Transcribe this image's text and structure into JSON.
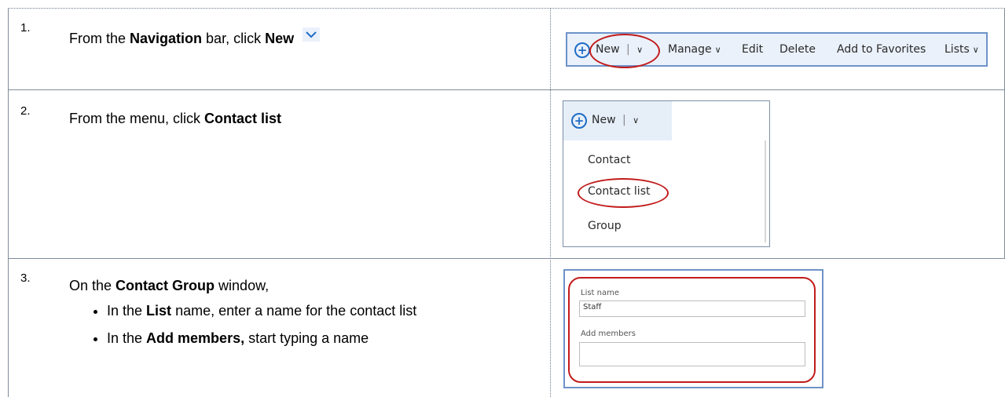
{
  "steps": [
    {
      "number": "1.",
      "text_pre": "From the ",
      "bold1": "Navigation",
      "text_mid": " bar, click ",
      "bold2": "New"
    },
    {
      "number": "2.",
      "text_pre": "From the menu, click ",
      "bold1": "Contact list"
    },
    {
      "number": "3.",
      "text_pre": "On the ",
      "bold1": "Contact Group",
      "text_post": " window,",
      "bullets": [
        {
          "pre": "In the ",
          "bold": "List",
          "post": " name, enter a name for the contact list"
        },
        {
          "pre": "In the ",
          "bold": "Add members,",
          "post": " start typing a name"
        }
      ]
    }
  ],
  "toolbar": {
    "new_label": "New",
    "separator": "|",
    "manage_label": "Manage",
    "edit_label": "Edit",
    "delete_label": "Delete",
    "favorites_label": "Add to Favorites",
    "lists_label": "Lists",
    "chevron": "∨"
  },
  "menu": {
    "new_label": "New",
    "separator": "|",
    "chevron": "∨",
    "items": [
      "Contact",
      "Contact list",
      "Group"
    ]
  },
  "form": {
    "list_name_label": "List name",
    "list_name_value": "Staff",
    "add_members_label": "Add members",
    "add_members_value": ""
  },
  "colors": {
    "accent_blue": "#1f6dc6",
    "highlight_red": "#c21b1b",
    "toolbar_bg": "#eaf1fb",
    "panel_border": "#6e92c9"
  }
}
